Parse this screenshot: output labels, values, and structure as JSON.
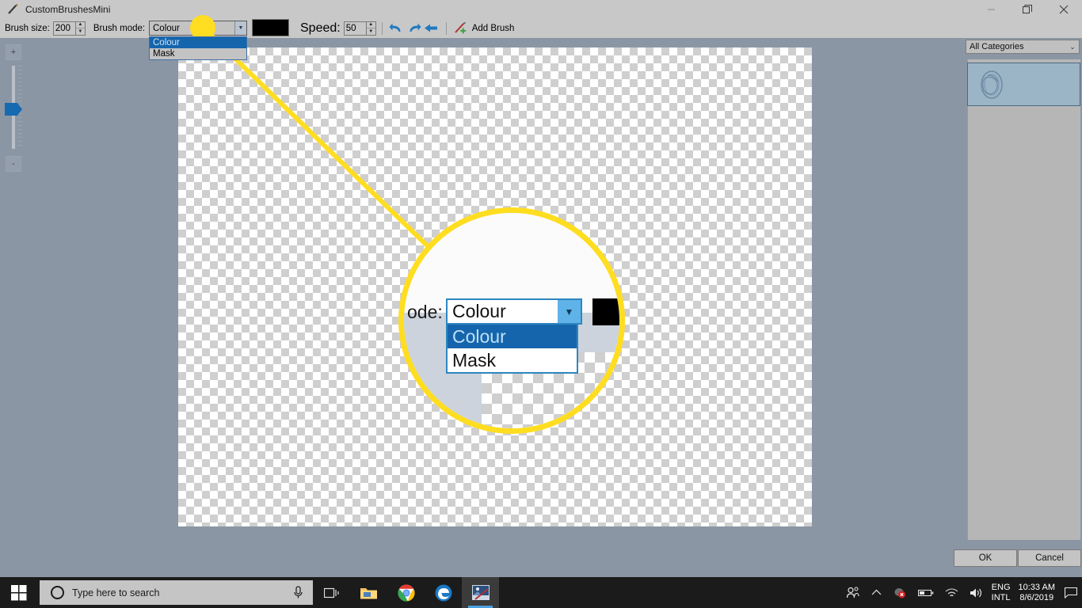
{
  "window": {
    "title": "CustomBrushesMini",
    "icon": "brush-icon",
    "minimize": "—",
    "maximize": "❐",
    "close": "✕"
  },
  "toolbar": {
    "brush_size_label": "Brush size:",
    "brush_size_value": "200",
    "brush_mode_label": "Brush mode:",
    "brush_mode_value": "Colour",
    "brush_mode_options": [
      "Colour",
      "Mask"
    ],
    "brush_mode_selected": "Colour",
    "color_swatch": "#000000",
    "speed_label": "Speed:",
    "speed_value": "50",
    "undo_icon": "undo-arrow-icon",
    "redo_icon": "redo-arrow-icon",
    "back_icon": "back-arrow-icon",
    "add_brush_label": "Add Brush",
    "add_brush_icon": "add-brush-icon",
    "spin_up": "▲",
    "spin_down": "▼",
    "combo_arrow": "▼"
  },
  "zoom_control": {
    "plus_label": "+",
    "minus_label": "-",
    "handle": "zoom-slider-handle"
  },
  "magnifier": {
    "label": "ode:",
    "combo_value": "Colour",
    "combo_arrow": "▼",
    "options": [
      "Colour",
      "Mask"
    ],
    "selected": "Colour",
    "swatch": "#000000",
    "ring_color": "#ffdd20"
  },
  "annotation": {
    "line_color": "#ffdd20",
    "dot_color": "#ffdd20"
  },
  "right_panel": {
    "category_value": "All Categories",
    "category_arrow": "⌄",
    "brush_item": "brush-thumbnail-oval"
  },
  "dialog": {
    "ok_label": "OK",
    "cancel_label": "Cancel"
  },
  "taskbar": {
    "start_icon": "windows-start-icon",
    "search_placeholder": "Type here to search",
    "cortana_icon": "cortana-circle-icon",
    "mic_icon": "microphone-icon",
    "taskview_icon": "task-view-icon",
    "explorer_icon": "file-explorer-icon",
    "chrome_icon": "chrome-icon",
    "edge_icon": "edge-icon",
    "paintshop_icon": "paintshop-pro-icon",
    "people_icon": "people-icon",
    "chevron_icon": "chevron-up-icon",
    "alert_icon": "alert-error-icon",
    "battery_icon": "battery-icon",
    "wifi_icon": "wifi-icon",
    "volume_icon": "volume-icon",
    "lang_line1": "ENG",
    "lang_line2": "INTL",
    "time": "10:33 AM",
    "date": "8/6/2019",
    "notification_icon": "notification-icon"
  }
}
